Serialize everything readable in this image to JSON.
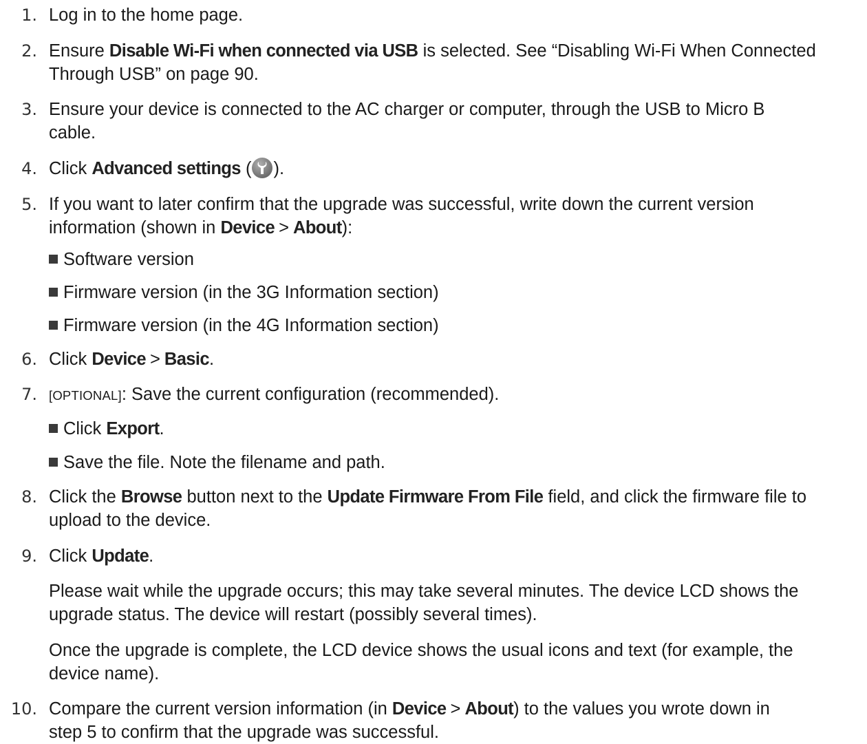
{
  "steps": [
    {
      "num": "1.",
      "text": "Log in to the home page."
    },
    {
      "num": "2.",
      "pre": "Ensure ",
      "bold": "Disable Wi-Fi when connected via USB",
      "post": " is selected. See “Disabling Wi-Fi When Connected",
      "line2": "Through USB” on page 90."
    },
    {
      "num": "3.",
      "line1": "Ensure your device is connected to the AC charger or computer, through the USB to Micro B",
      "line2": "cable."
    },
    {
      "num": "4.",
      "pre": "Click ",
      "bold": "Advanced settings",
      "open": " (",
      "close": ")."
    },
    {
      "num": "5.",
      "line1": "If you want to later confirm that the upgrade was successful, write down the current version",
      "pre2": "information (shown in ",
      "bold_a": "Device",
      "gt": ">",
      "bold_b": "About",
      "post2": "):"
    },
    {
      "num": "6.",
      "pre": "Click ",
      "bold_a": "Device",
      "gt": ">",
      "bold_b": "Basic",
      "post": "."
    },
    {
      "num": "7.",
      "optional": "[OPTIONAL]",
      "post": ": Save the current configuration (recommended)."
    },
    {
      "num": "8.",
      "pre": "Click the ",
      "bold_a": "Browse",
      "mid": " button next to the ",
      "bold_b": "Update Firmware From File",
      "post": " field, and click the firmware file to",
      "line2": "upload to the device."
    },
    {
      "num": "9.",
      "pre": "Click ",
      "bold": "Update",
      "post": "."
    },
    {
      "num": "10.",
      "pre": "Compare the current version information (in ",
      "bold_a": "Device",
      "gt": ">",
      "bold_b": "About",
      "post": ") to the values you wrote down in",
      "line2": "step 5 to confirm that the upgrade was successful."
    }
  ],
  "step5_bullets": [
    "Software version",
    "Firmware version (in the 3G Information section)",
    "Firmware version (in the 4G Information section)"
  ],
  "step7_bullets": {
    "b1_pre": "Click ",
    "b1_bold": "Export",
    "b1_post": ".",
    "b2": "Save the file. Note the filename and path."
  },
  "step9_paras": {
    "p1_l1": "Please wait while the upgrade occurs; this may take several minutes. The device LCD shows the",
    "p1_l2": "upgrade status. The device will restart (possibly several times).",
    "p2_l1": "Once the upgrade is complete, the LCD device shows the usual icons and text (for example, the",
    "p2_l2": "device name)."
  },
  "icons": {
    "advanced_settings": "wrench-icon"
  }
}
